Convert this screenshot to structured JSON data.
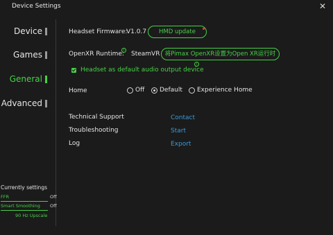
{
  "window": {
    "title": "Device Settings"
  },
  "icons": {
    "close": "close-icon",
    "info": "info-icon",
    "check": "checkbox-checked-icon"
  },
  "colors": {
    "accent": "#46d246",
    "link": "#3a9bd8",
    "background": "#1b1b1b",
    "alert_dot": "#e04040"
  },
  "sidebar": {
    "items": [
      {
        "label": "Device",
        "active": false
      },
      {
        "label": "Games",
        "active": false
      },
      {
        "label": "General",
        "active": true
      },
      {
        "label": "Advanced",
        "active": false
      }
    ]
  },
  "current_settings": {
    "title": "Currently settings",
    "rows": [
      {
        "name": "FFR",
        "value": "Off"
      },
      {
        "name": "Smart Smoothing",
        "value": "Off"
      }
    ],
    "upscale": "90 Hz Upscale"
  },
  "general": {
    "firmware_label": "Headset Firmware:",
    "firmware_version": "V1.0.7",
    "hmd_update_label": "HMD update",
    "openxr_label": "OpenXR Runtime:",
    "openxr_value": "SteamVR",
    "openxr_button_label": "将Pimax OpenXR设置为Open XR运行时",
    "audio_checkbox_label": "Headset as default audio output device",
    "audio_checkbox_checked": true,
    "home_label": "Home",
    "home_options": [
      {
        "label": "Off",
        "selected": false
      },
      {
        "label": "Default",
        "selected": true
      },
      {
        "label": "Experience Home",
        "selected": false
      }
    ],
    "support_rows": [
      {
        "label": "Technical Support",
        "link": "Contact"
      },
      {
        "label": "Troubleshooting",
        "link": "Start"
      },
      {
        "label": "Log",
        "link": "Export"
      }
    ]
  }
}
